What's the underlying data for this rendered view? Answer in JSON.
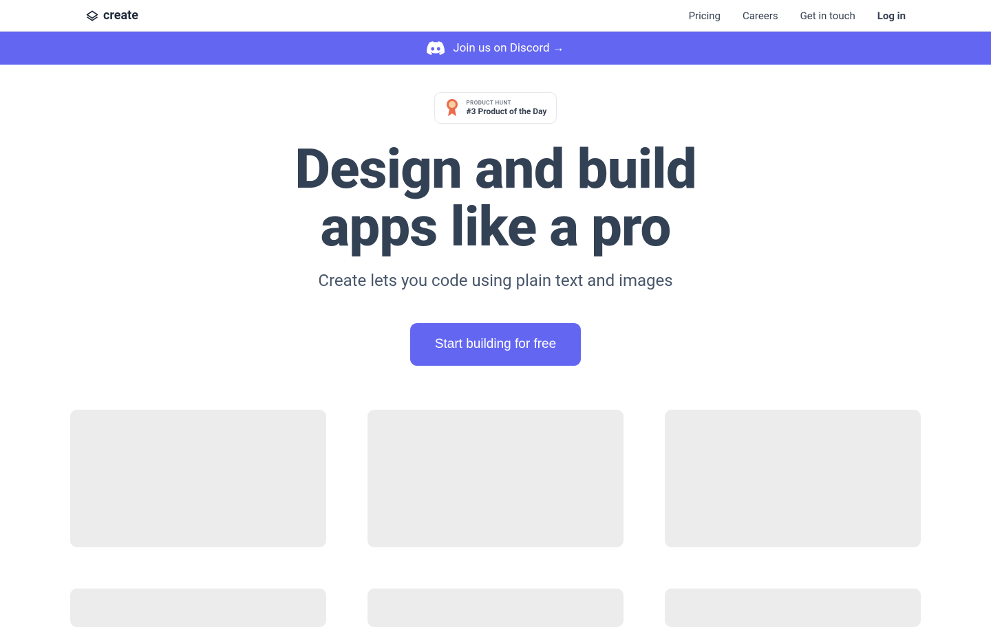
{
  "header": {
    "logo_text": "create",
    "nav": {
      "pricing": "Pricing",
      "careers": "Careers",
      "contact": "Get in touch",
      "login": "Log in"
    }
  },
  "banner": {
    "text": "Join us on Discord →"
  },
  "product_hunt": {
    "label": "PRODUCT HUNT",
    "rank": "#3 Product of the Day"
  },
  "hero": {
    "title_line1": "Design and build",
    "title_line2": "apps like a pro",
    "subtitle": "Create lets you code using plain text and images",
    "cta": "Start building for free"
  }
}
